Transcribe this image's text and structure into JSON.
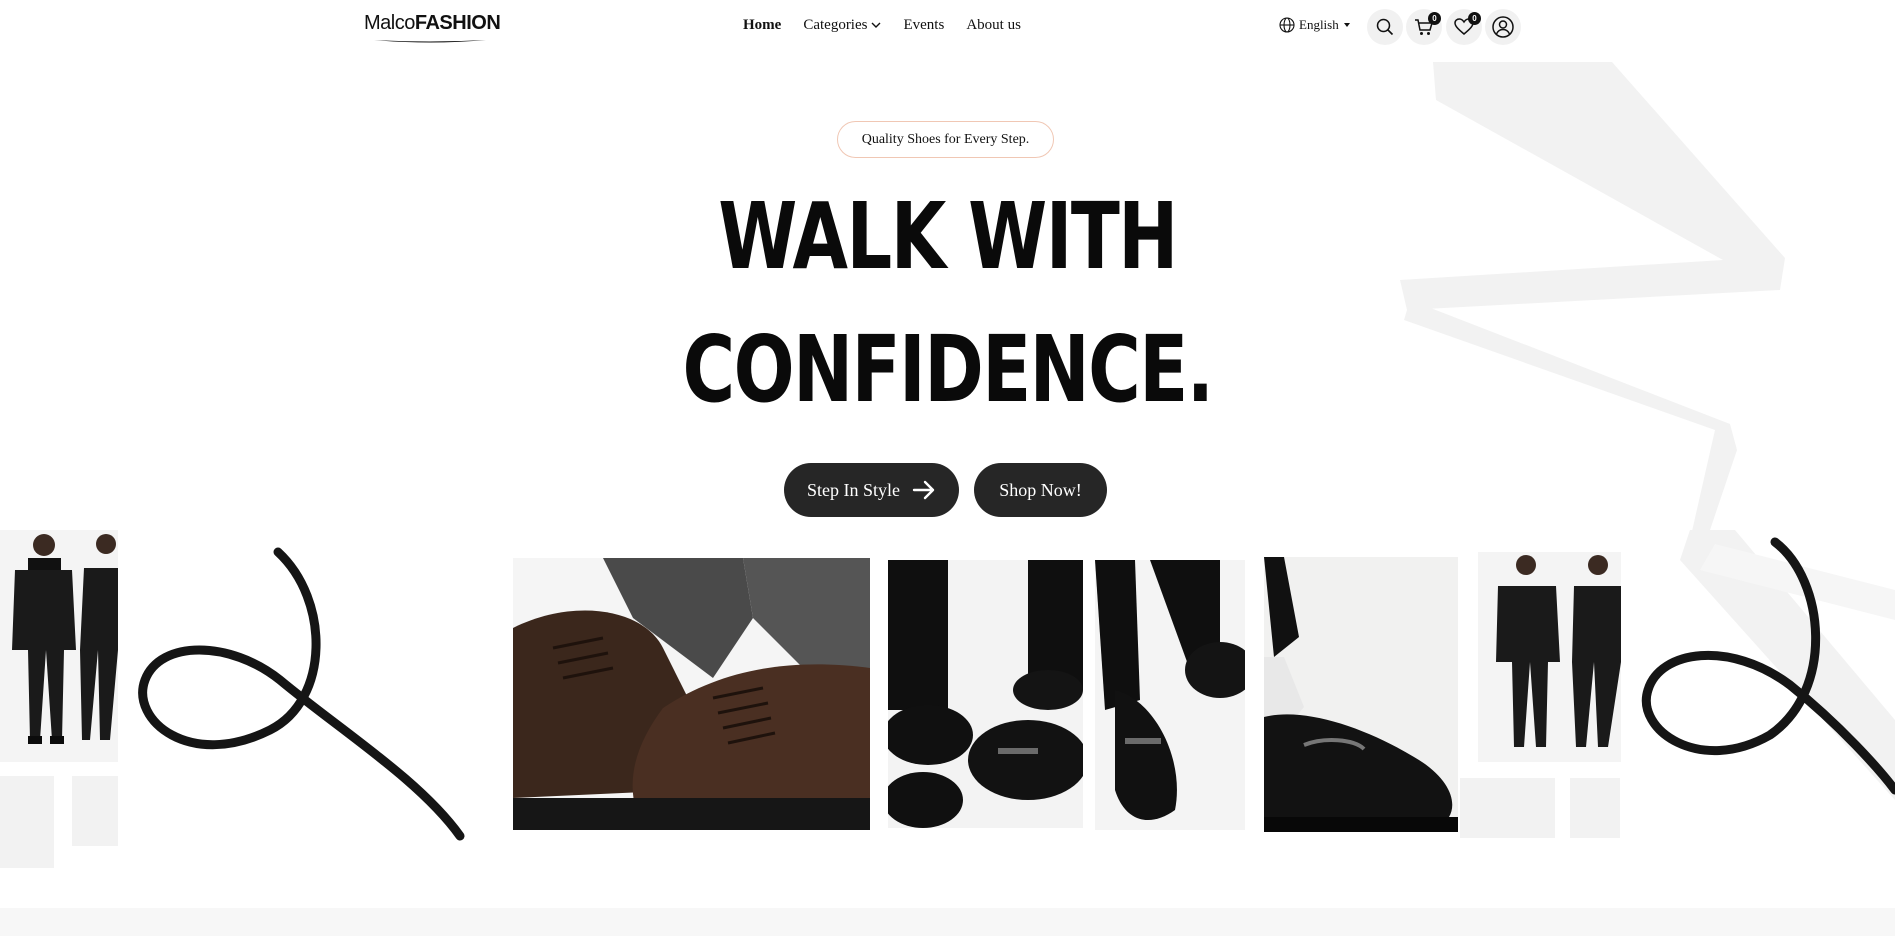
{
  "header": {
    "logo": {
      "part1": "Malco",
      "part2": "FASHION"
    },
    "nav": [
      {
        "label": "Home",
        "active": true
      },
      {
        "label": "Categories",
        "has_dropdown": true
      },
      {
        "label": "Events"
      },
      {
        "label": "About us"
      }
    ],
    "language": "English",
    "cart_count": "0",
    "wishlist_count": "0",
    "icons": [
      "globe-icon",
      "caret-down-icon",
      "search-icon",
      "cart-icon",
      "heart-icon",
      "user-icon"
    ]
  },
  "hero": {
    "tagline": "Quality Shoes for Every Step.",
    "headline_line1": "WALK WITH",
    "headline_line2": "CONFIDENCE.",
    "cta_primary": "Step In Style",
    "cta_secondary": "Shop Now!"
  },
  "colors": {
    "button_bg": "#262626",
    "pill_border": "#f0c7b4",
    "deco_gray": "#f2f2f2",
    "text": "#111111"
  }
}
